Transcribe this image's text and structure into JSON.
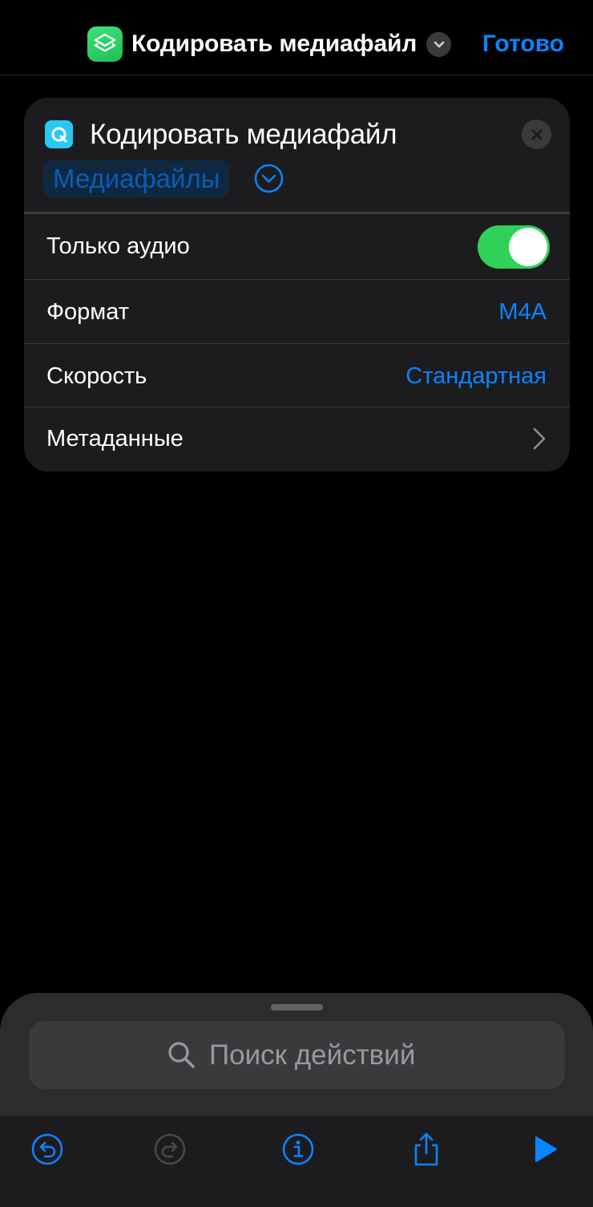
{
  "nav": {
    "title": "Кодировать медиафайл",
    "done_label": "Готово",
    "app_icon": "shortcuts-layers-icon",
    "title_menu_icon": "chevron-down-icon"
  },
  "action": {
    "title": "Кодировать медиафайл",
    "icon": "quicktime-icon",
    "input_token": "Медиафайлы",
    "expand_icon": "chevron-down-circle-icon",
    "close_icon": "close-icon"
  },
  "params": {
    "audio_only": {
      "label": "Только аудио",
      "enabled": true
    },
    "format": {
      "label": "Формат",
      "value": "M4A"
    },
    "speed": {
      "label": "Скорость",
      "value": "Стандартная"
    },
    "metadata": {
      "label": "Метаданные",
      "icon": "chevron-right-icon"
    }
  },
  "sheet": {
    "search_placeholder": "Поиск действий",
    "search_icon": "search-icon"
  },
  "toolbar": {
    "undo_icon": "undo-icon",
    "redo_icon": "redo-icon",
    "info_icon": "info-icon",
    "share_icon": "share-icon",
    "run_icon": "play-icon"
  },
  "colors": {
    "accent": "#0a84ff",
    "toggle_on": "#30d158",
    "card_bg": "#1c1c1e",
    "background": "#000000",
    "app_icon": "#2fd36b",
    "action_icon": "#29c8f5"
  }
}
